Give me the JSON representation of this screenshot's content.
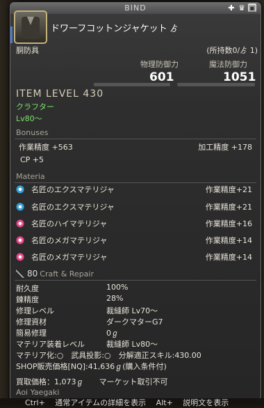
{
  "window": {
    "title": "BIND"
  },
  "item": {
    "name": "ドワーフコットンジャケット",
    "hq_symbol": "ゟ",
    "category": "胴防具",
    "owned": "(所持数0/ゟ 1)"
  },
  "stats": {
    "phys_label": "物理防御力",
    "phys_value": "601",
    "mag_label": "魔法防御力",
    "mag_value": "1051"
  },
  "item_level": "ITEM LEVEL 430",
  "class": {
    "job": "クラフター",
    "level": "Lv80～"
  },
  "bonuses": {
    "header": "Bonuses",
    "items": [
      {
        "label": "作業精度 +563",
        "label2": "加工精度 +178"
      },
      {
        "label": "CP +5",
        "label2": ""
      }
    ]
  },
  "materia": {
    "header": "Materia",
    "items": [
      {
        "name": "名匠のエクスマテリジャ",
        "value": "作業精度+21",
        "color": "blue"
      },
      {
        "name": "名匠のエクスマテリジャ",
        "value": "作業精度+21",
        "color": "blue"
      },
      {
        "name": "名匠のハイマテリジャ",
        "value": "作業精度+16",
        "color": "pink"
      },
      {
        "name": "名匠のメガマテリジャ",
        "value": "作業精度+14",
        "color": "pink"
      },
      {
        "name": "名匠のメガマテリジャ",
        "value": "作業精度+14",
        "color": "pink"
      }
    ]
  },
  "repair": {
    "header_num": "80",
    "header_text": "Craft & Repair",
    "rows": [
      {
        "k": "耐久度",
        "v": "100%"
      },
      {
        "k": "錬精度",
        "v": "28%"
      },
      {
        "k": "修理レベル",
        "v": "裁縫師 Lv70～"
      },
      {
        "k": "修理資材",
        "v": "ダークマターG7"
      },
      {
        "k": "簡易修理",
        "v": "0ℊ"
      },
      {
        "k": "マテリア装着レベル",
        "v": "裁縫師 Lv80～"
      }
    ]
  },
  "misc": {
    "materia_line": "マテリア化:○　武具投影:○　分解適正スキル:430.00",
    "shop_line": "SHOP販売価格[NQ]:41,636ℊ(購入条件付)",
    "buyback_line": "買取価格：1,073ℊ　　マーケット取引不可",
    "crafter": "Aoi Yaegaki"
  },
  "footer": {
    "text": "Ctrl+　 通常アイテムの詳細を表示　 Alt+　 説明文を表示"
  }
}
